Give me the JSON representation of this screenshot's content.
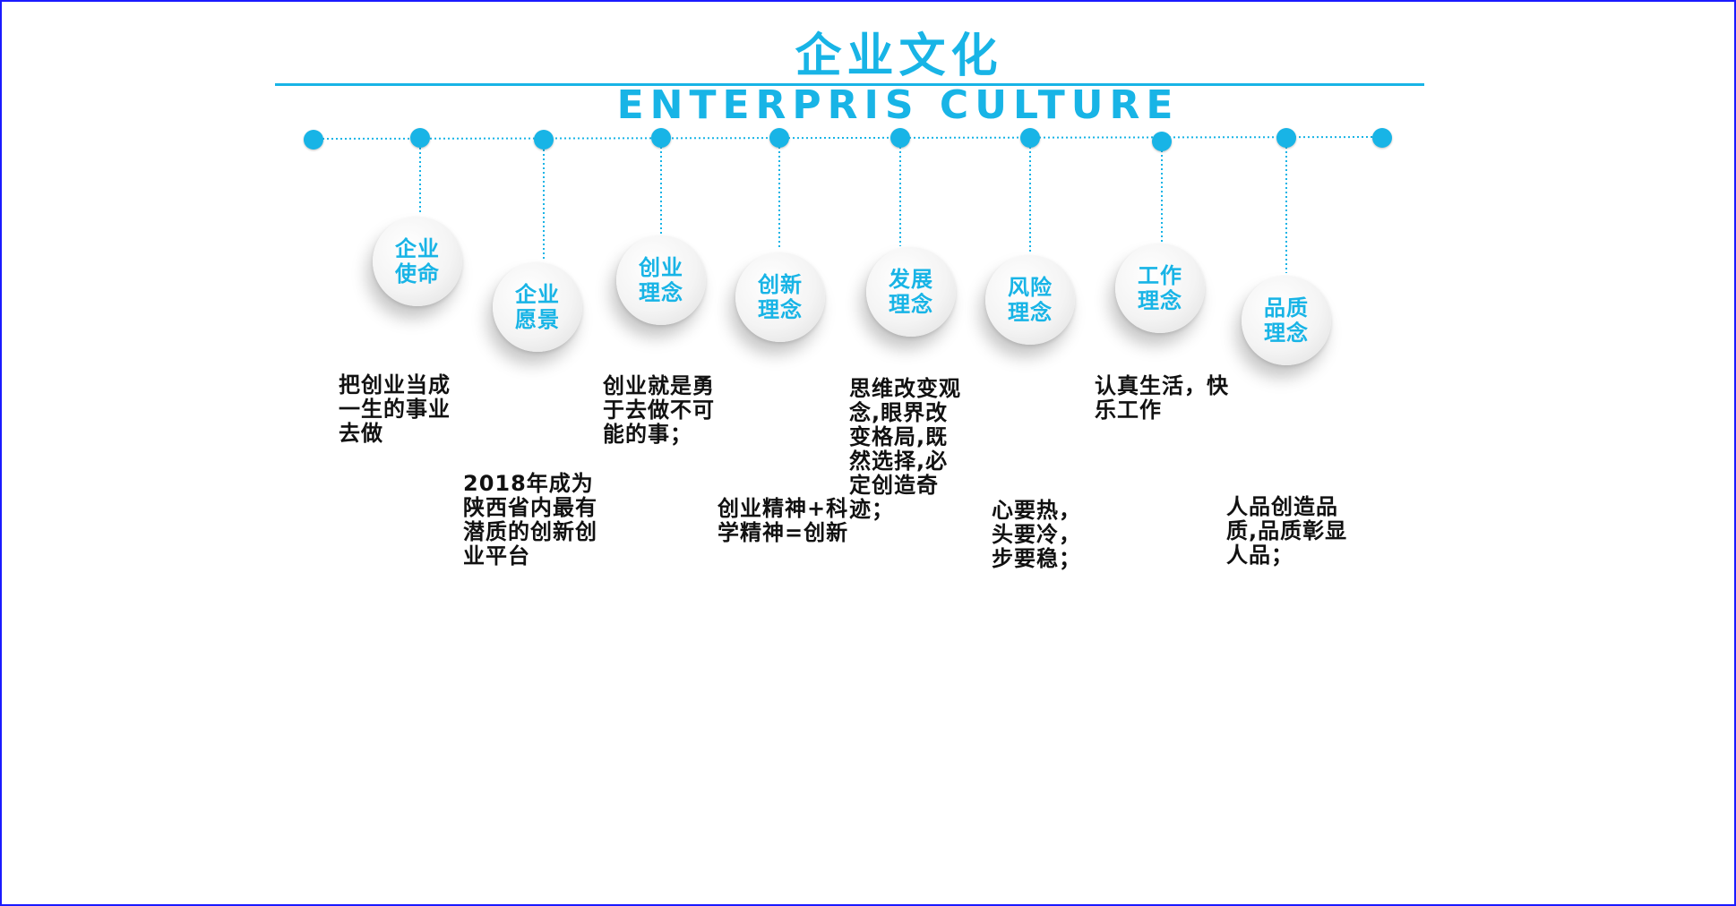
{
  "title": {
    "cn": "企业文化",
    "en": "ENTERPRIS CULTURE"
  },
  "colors": {
    "accent": "#18b4e6",
    "text": "#111111",
    "border": "#1a1aff"
  },
  "items": [
    {
      "label": "企业使命",
      "desc": "把创业当成一生的事业去做"
    },
    {
      "label": "企业愿景",
      "desc": "2018年成为陕西省内最有潜质的创新创业平台"
    },
    {
      "label": "创业理念",
      "desc": "创业就是勇于去做不可能的事；"
    },
    {
      "label": "创新理念",
      "desc": "创业精神+科学精神=创新"
    },
    {
      "label": "发展理念",
      "desc": "思维改变观念,眼界改变格局,既然选择,必定创造奇迹；"
    },
    {
      "label": "风险理念",
      "desc": "心要热，头要冷，步要稳；"
    },
    {
      "label": "工作理念",
      "desc": "认真生活，快乐工作"
    },
    {
      "label": "品质理念",
      "desc": "人品创造品质,品质彰显人品；"
    }
  ]
}
